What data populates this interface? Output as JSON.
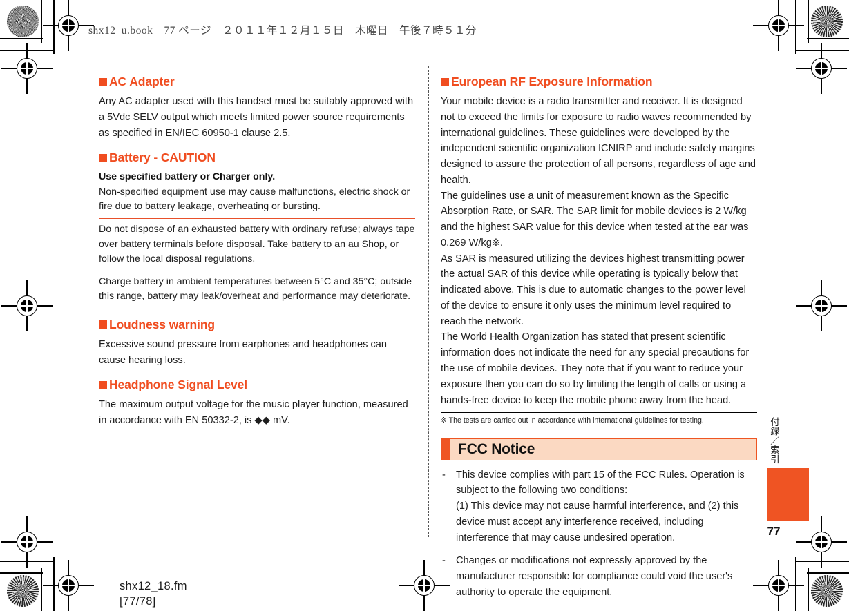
{
  "running_head": "shx12_u.book　77 ページ　２０１１年１２月１５日　木曜日　午後７時５１分",
  "colors": {
    "accent_orange": "#f04d20",
    "banner_fill": "#fbd9c2",
    "banner_border": "#ee5522",
    "tab_orange": "#ef5423",
    "body_text": "#1e1e1e"
  },
  "left_column": {
    "sections": [
      {
        "heading": "AC Adapter",
        "paragraph": "Any AC adapter used with this handset must be suitably approved with a 5Vdc SELV output which meets limited power source requirements as specified in EN/IEC 60950-1 clause 2.5."
      },
      {
        "heading": "Battery - CAUTION",
        "caution_lead": "Use specified battery or Charger only.",
        "caution_items": [
          "Non-specified equipment use may cause malfunctions, electric shock or fire due to battery leakage, overheating or bursting.",
          "Do not dispose of an exhausted battery with ordinary refuse; always tape over battery terminals before disposal. Take battery to an au Shop, or follow the local disposal regulations.",
          "Charge battery in ambient temperatures between 5°C and 35°C; outside this range, battery may leak/overheat and performance may deteriorate."
        ]
      },
      {
        "heading": "Loudness warning",
        "paragraph": "Excessive sound pressure from earphones and headphones can cause hearing loss."
      },
      {
        "heading": "Headphone Signal Level",
        "paragraph": "The maximum output voltage for the music player function, measured in accordance with EN 50332-2, is ◆◆ mV."
      }
    ]
  },
  "right_column": {
    "heading": "European RF Exposure Information",
    "paragraphs": [
      "Your mobile device is a radio transmitter and receiver. It is designed not to exceed the limits for exposure to radio waves recommended by international guidelines. These guidelines were developed by the independent scientific organization ICNIRP and include safety margins designed to assure the protection of all persons, regardless of age and health.",
      "The guidelines use a unit of measurement known as the Specific Absorption Rate, or SAR. The SAR limit for mobile devices is 2 W/kg and the highest SAR value for this device when tested at the ear was 0.269 W/kg※.",
      "As SAR is measured utilizing the devices highest transmitting power the actual SAR of this device while operating is typically below that indicated above. This is due to automatic changes to the power level of the device to ensure it only uses the minimum level required to reach the network.",
      "The World Health Organization has stated that present scientific information does not indicate the need for any special precautions for the use of mobile devices. They note that if you want to reduce your exposure then you can do so by limiting the length of calls or using a hands-free device to keep the mobile phone away from the head."
    ],
    "footnote": "※ The tests are carried out in accordance with international guidelines for testing.",
    "fcc_banner_title": "FCC Notice",
    "fcc_items": [
      "This device complies with part 15 of the FCC Rules. Operation is subject to the following two conditions:\n(1) This device may not cause harmful interference, and (2) this device must accept any interference received, including interference that may cause undesired operation.",
      "Changes or modifications not expressly approved by the manufacturer responsible for compliance could void the user's authority to operate the equipment."
    ],
    "dash_mark": "-"
  },
  "side_tab": {
    "label": "付録／索引",
    "page_number": "77"
  },
  "footer": {
    "filename": "shx12_18.fm",
    "page_range": "[77/78]"
  }
}
